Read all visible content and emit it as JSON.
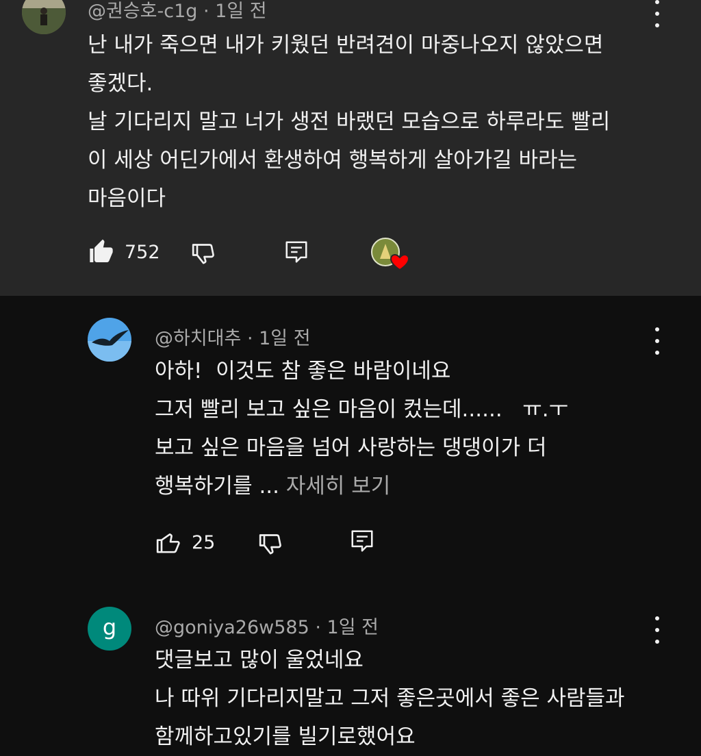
{
  "comments": [
    {
      "author": "@권승호-c1g",
      "time": "1일 전",
      "meta": "@권승호-c1g · 1일 전",
      "text": "난 내가 죽으면 내가 키웠던 반려견이 마중나오지 않았으면\n좋겠다.\n날 기다리지 말고 너가 생전 바랬던 모습으로 하루라도 빨리\n이 세상 어딘가에서 환생하여 행복하게 살아가길 바라는\n마음이다",
      "likes": "752",
      "liked": true,
      "creator_heart": true
    },
    {
      "author": "@하치대추",
      "time": "1일 전",
      "meta": "@하치대추 · 1일 전",
      "text": "아하!  이것도 참 좋은 바람이네요\n그저 빨리 보고 싶은 마음이 컸는데......   ㅠ.ㅜ\n보고 싶은 마음을 넘어 사랑하는 댕댕이가 더\n행복하기를 ... ",
      "more": "자세히 보기",
      "likes": "25",
      "liked": false
    },
    {
      "author": "@goniya26w585",
      "time": "1일 전",
      "meta": "@goniya26w585 · 1일 전",
      "avatar_letter": "g",
      "avatar_color": "#00897b",
      "text": "댓글보고 많이 울었네요\n나 따위 기다리지말고 그저 좋은곳에서 좋은 사람들과\n함께하고있기를 빌기로했어요"
    }
  ],
  "colors": {
    "highlight_bg": "#272727",
    "page_bg": "#0f0f0f",
    "heart": "#ff0000"
  }
}
